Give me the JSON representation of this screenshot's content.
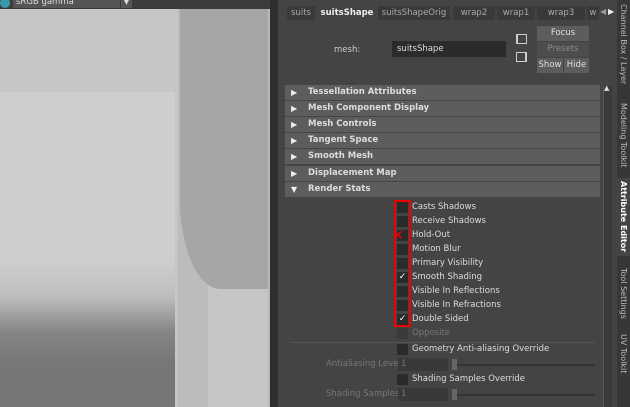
{
  "viewport": {
    "color_space": "sRGB gamma"
  },
  "tabs": [
    {
      "label": "suits"
    },
    {
      "label": "suitsShape",
      "active": true
    },
    {
      "label": "suitsShapeOrig"
    },
    {
      "label": "wrap2"
    },
    {
      "label": "wrap1"
    },
    {
      "label": "wrap3"
    },
    {
      "label": "w"
    }
  ],
  "mesh": {
    "label": "mesh:",
    "value": "suitsShape"
  },
  "buttons": {
    "focus": "Focus",
    "presets": "Presets",
    "show": "Show",
    "hide": "Hide"
  },
  "sections": [
    "Tessellation Attributes",
    "Mesh Component Display",
    "Mesh Controls",
    "Tangent Space",
    "Smooth Mesh",
    "Displacement Map",
    "Render Stats"
  ],
  "render_stats": [
    {
      "label": "Casts Shadows",
      "checked": false
    },
    {
      "label": "Receive Shadows",
      "checked": false
    },
    {
      "label": "Hold-Out",
      "checked": false
    },
    {
      "label": "Motion Blur",
      "checked": false
    },
    {
      "label": "Primary Visibility",
      "checked": false
    },
    {
      "label": "Smooth Shading",
      "checked": true
    },
    {
      "label": "Visible In Reflections",
      "checked": false
    },
    {
      "label": "Visible In Refractions",
      "checked": false
    },
    {
      "label": "Double Sided",
      "checked": true
    },
    {
      "label": "Opposite",
      "checked": false
    }
  ],
  "aa": {
    "override": "Geometry Anti-aliasing Override",
    "level_label": "Antialiasing Level",
    "level_value": "1"
  },
  "shading": {
    "override": "Shading Samples Override",
    "samples_label": "Shading Samples",
    "samples_value": "1"
  },
  "side_tabs": [
    "Channel Box / Layer Editor",
    "Modeling Toolkit",
    "Attribute Editor",
    "Tool Settings",
    "UV Toolkit"
  ],
  "colors": {
    "highlight": "#e00000"
  }
}
